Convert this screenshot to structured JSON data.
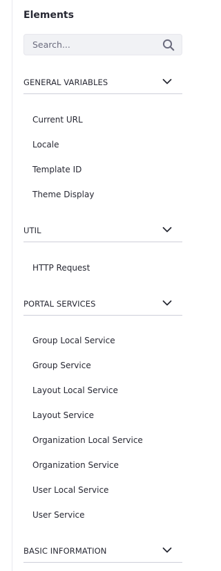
{
  "panel": {
    "title": "Elements"
  },
  "search": {
    "placeholder": "Search...",
    "icon": "search-icon"
  },
  "sections": {
    "general": {
      "label": "GENERAL VARIABLES",
      "icon": "chevron-down-icon",
      "items": [
        "Current URL",
        "Locale",
        "Template ID",
        "Theme Display"
      ]
    },
    "util": {
      "label": "UTIL",
      "icon": "chevron-down-icon",
      "items": [
        "HTTP Request"
      ]
    },
    "portal": {
      "label": "PORTAL SERVICES",
      "icon": "chevron-down-icon",
      "items": [
        "Group Local Service",
        "Group Service",
        "Layout Local Service",
        "Layout Service",
        "Organization Local Service",
        "Organization Service",
        "User Local Service",
        "User Service"
      ]
    },
    "basic": {
      "label": "BASIC INFORMATION",
      "icon": "chevron-down-icon"
    }
  },
  "colors": {
    "text": "#272833",
    "placeholder": "#6b6c7e",
    "search_bg": "#f1f2f5",
    "divider": "#cdced9",
    "border": "#e7e7ed"
  }
}
